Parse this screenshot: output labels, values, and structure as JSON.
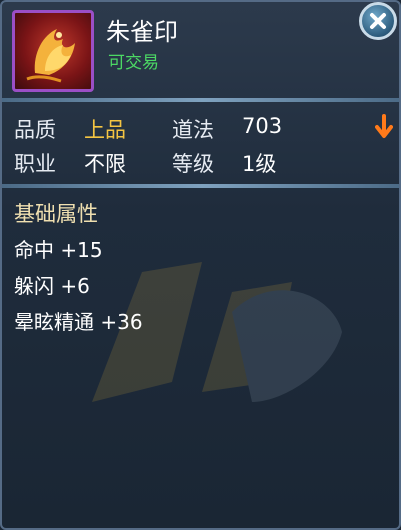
{
  "item": {
    "name": "朱雀印",
    "trade_status": "可交易",
    "icon": "phoenix-icon"
  },
  "close": {
    "icon": "close-icon"
  },
  "stats": {
    "quality_label": "品质",
    "quality_value": "上品",
    "daofa_label": "道法",
    "daofa_value": "703",
    "job_label": "职业",
    "job_value": "不限",
    "level_label": "等级",
    "level_value": "1级"
  },
  "attributes": {
    "title": "基础属性",
    "lines": [
      "命中 +15",
      "躲闪 +6",
      "晕眩精通 +36"
    ]
  },
  "colors": {
    "quality": "#f5c542",
    "trade": "#4cd964",
    "icon_border": "#9b4fc6"
  }
}
